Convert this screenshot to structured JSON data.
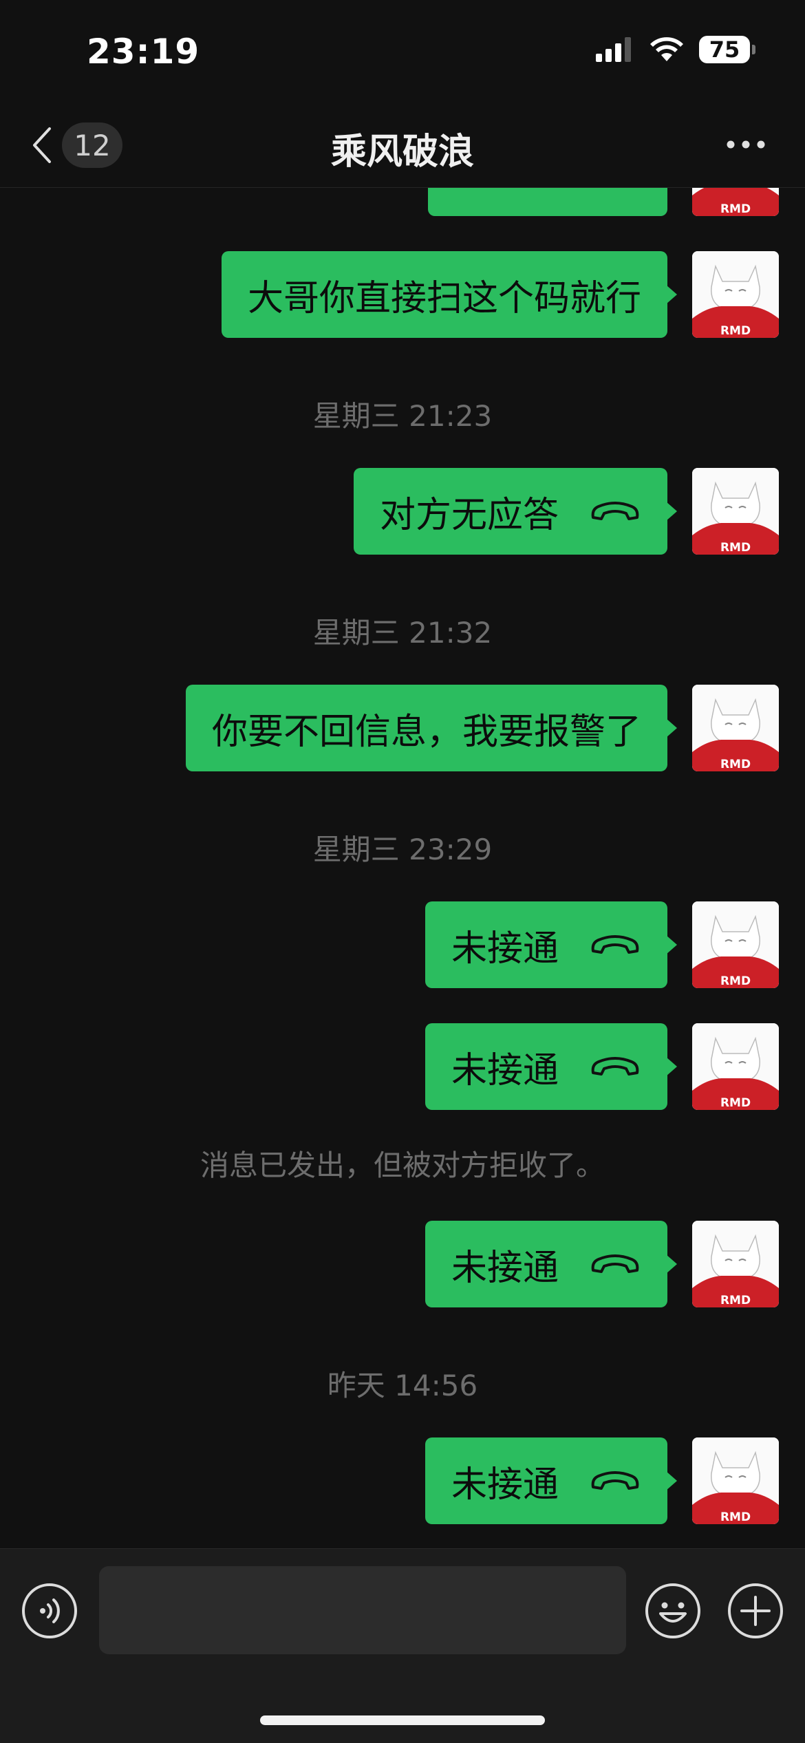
{
  "status_bar": {
    "time": "23:19",
    "battery": "75"
  },
  "nav": {
    "unread_count": "12",
    "title": "乘风破浪"
  },
  "messages": [
    {
      "text": "大哥你直接扫这个码就行"
    },
    {
      "timestamp": "星期三 21:23"
    },
    {
      "text": "对方无应答",
      "call_icon": "phone-hangup-icon"
    },
    {
      "timestamp": "星期三 21:32"
    },
    {
      "text": "你要不回信息，我要报警了"
    },
    {
      "timestamp": "星期三 23:29"
    },
    {
      "text": "未接通",
      "call_icon": "phone-hangup-icon"
    },
    {
      "text": "未接通",
      "call_icon": "phone-hangup-icon"
    },
    {
      "system_notice": "消息已发出，但被对方拒收了。"
    },
    {
      "text": "未接通",
      "call_icon": "phone-hangup-icon"
    },
    {
      "timestamp": "昨天 14:56"
    },
    {
      "text": "未接通",
      "call_icon": "phone-hangup-icon"
    }
  ],
  "avatar": {
    "label": "RMD",
    "icon": "cat-in-red-hoodie-avatar"
  },
  "colors": {
    "background": "#111111",
    "bubble": "#2bbd5f",
    "timestamp": "#6d6d6d",
    "avatar_hoodie": "#cc2027"
  }
}
